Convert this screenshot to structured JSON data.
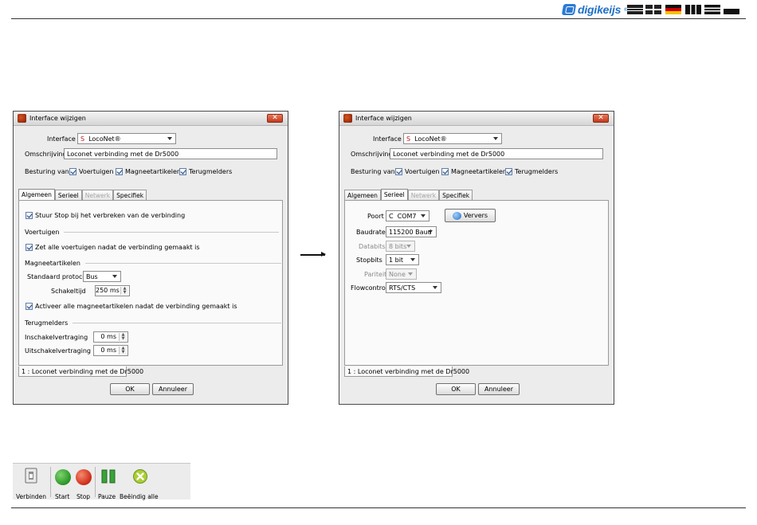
{
  "header": {
    "logo_text": "digikeijs",
    "logo_reg": "®",
    "flags": [
      "nl-flag",
      "uk-flag",
      "de-flag",
      "fr-flag",
      "it-flag",
      "lu-flag"
    ]
  },
  "left_dialog": {
    "title": "Interface wijzigen",
    "close": "✕",
    "interface_label": "Interface",
    "interface_prefix": "S",
    "interface_value": "LocoNet®",
    "description_label": "Omschrijving",
    "description_value": "Loconet verbinding met de Dr5000",
    "control_label": "Besturing van",
    "control_vehicles": "Voertuigen",
    "control_magnets": "Magneetartikelen",
    "control_feedback": "Terugmelders",
    "tabs": [
      "Algemeen",
      "Serieel",
      "Netwerk",
      "Specifiek"
    ],
    "stop_on_disconnect": "Stuur Stop bij het verbreken van de verbinding",
    "vehicles_section": "Voertuigen",
    "vehicles_off_after_connect": "Zet alle voertuigen nadat de verbinding gemaakt is",
    "magnets_section": "Magneetartikelen",
    "protocol_label": "Standaard protocol",
    "protocol_value": "Bus",
    "switch_time_label": "Schakeltijd",
    "switch_time_value": "250 ms",
    "activate_magnets": "Activeer alle magneetartikelen nadat de verbinding gemaakt is",
    "feedback_section": "Terugmelders",
    "on_delay_label": "Inschakelvertraging",
    "on_delay_value": "0 ms",
    "off_delay_label": "Uitschakelvertraging",
    "off_delay_value": "0 ms",
    "bottom_tab": "1 : Loconet verbinding met de Dr5000",
    "ok": "OK",
    "cancel": "Annuleer"
  },
  "right_dialog": {
    "title": "Interface wijzigen",
    "close": "✕",
    "interface_label": "Interface",
    "interface_prefix": "S",
    "interface_value": "LocoNet®",
    "description_label": "Omschrijving",
    "description_value": "Loconet verbinding met de Dr5000",
    "control_label": "Besturing van",
    "control_vehicles": "Voertuigen",
    "control_magnets": "Magneetartikelen",
    "control_feedback": "Terugmelders",
    "tabs": [
      "Algemeen",
      "Serieel",
      "Netwerk",
      "Specifiek"
    ],
    "port_label": "Poort",
    "port_prefix": "C",
    "port_value": "COM7",
    "refresh": "Ververs",
    "baud_label": "Baudrate",
    "baud_value": "115200 Baud",
    "databits_label": "Databits",
    "databits_value": "8 bits",
    "stopbits_label": "Stopbits",
    "stopbits_value": "1 bit",
    "parity_label": "Pariteit",
    "parity_value": "None",
    "flow_label": "Flowcontrol",
    "flow_value": "RTS/CTS",
    "bottom_tab": "1 : Loconet verbinding met de Dr5000",
    "ok": "OK",
    "cancel": "Annuleer"
  },
  "toolbar": {
    "connect": "Verbinden",
    "start": "Start",
    "stop": "Stop",
    "pause": "Pauze",
    "end_all": "Beëindig alle",
    "colors": {
      "start": "#2f9a2a",
      "stop": "#d2311c",
      "pause": "#3aa33a",
      "end": "#9bc92a"
    }
  }
}
